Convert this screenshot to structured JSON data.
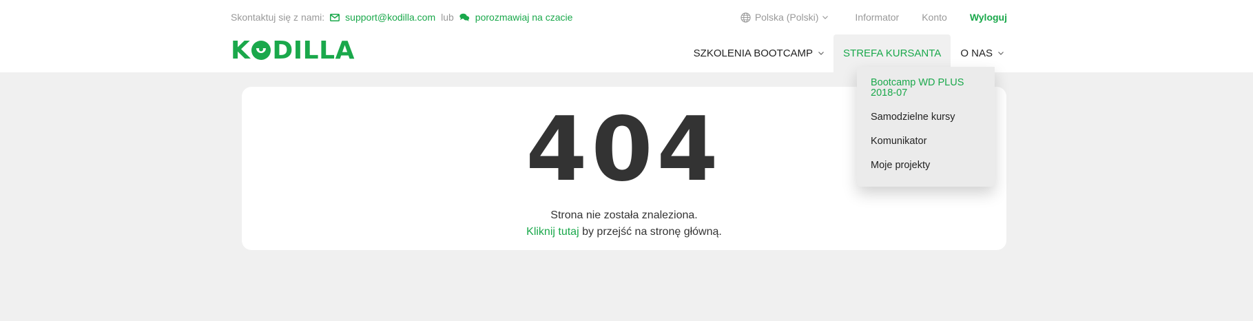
{
  "topbar": {
    "contact_label": "Skontaktuj się z nami:",
    "email": "support@kodilla.com",
    "or": "lub",
    "chat": "porozmawiaj na czacie",
    "language": "Polska (Polski)",
    "links": [
      "Informator",
      "Konto"
    ],
    "logout": "Wyloguj"
  },
  "logo": {
    "text": "KODILLA",
    "icon": "kodilla-logo"
  },
  "nav": {
    "items": [
      {
        "label": "SZKOLENIA BOOTCAMP",
        "has_dropdown": true
      },
      {
        "label": "STREFA KURSANTA",
        "active": true
      },
      {
        "label": "O NAS",
        "has_dropdown": true
      }
    ]
  },
  "dropdown": {
    "items": [
      {
        "label": "Bootcamp WD PLUS 2018-07",
        "active": true
      },
      {
        "label": "Samodzielne kursy"
      },
      {
        "label": "Komunikator"
      },
      {
        "label": "Moje projekty"
      }
    ]
  },
  "error": {
    "code": "404",
    "message": "Strona nie została znaleziona.",
    "link": "Kliknij tutaj",
    "after_link": " by przejść na stronę główną."
  },
  "colors": {
    "accent": "#1aa84b",
    "background": "#f0f0f0",
    "text": "#333333"
  }
}
